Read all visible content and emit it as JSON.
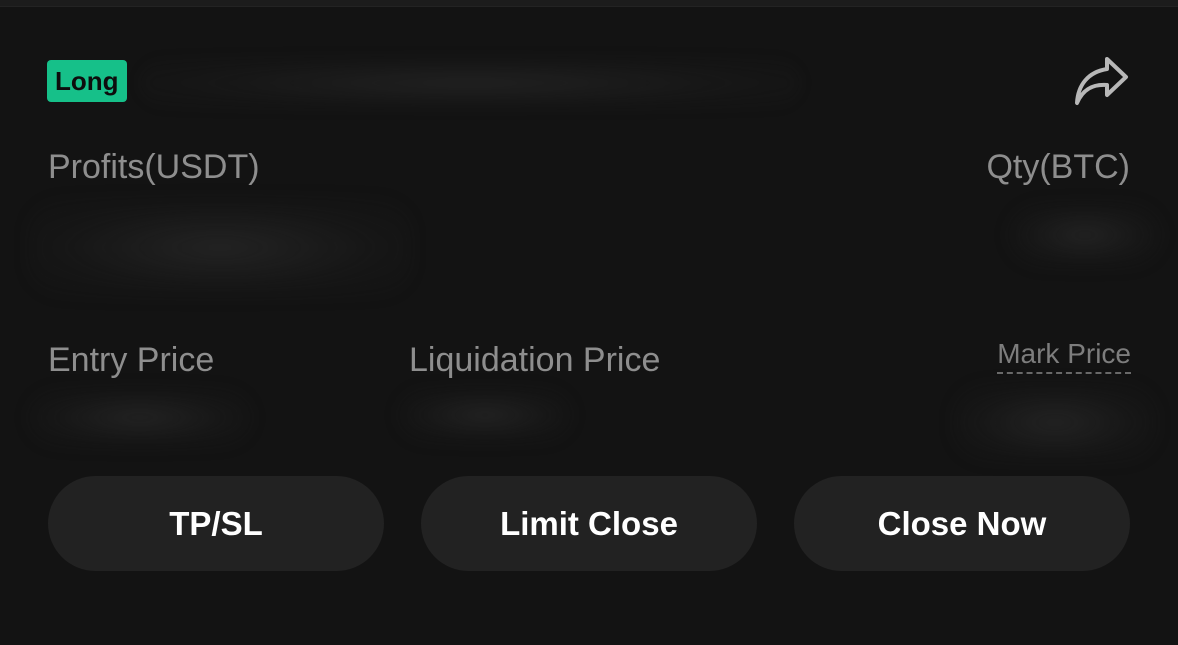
{
  "position": {
    "side_badge": "Long",
    "badge_color": "#16c089"
  },
  "header": {
    "share_icon": "share-icon"
  },
  "labels": {
    "profits": "Profits(USDT)",
    "qty": "Qty(BTC)",
    "entry_price": "Entry Price",
    "liquidation_price": "Liquidation Price",
    "mark_price": "Mark Price"
  },
  "actions": {
    "tpsl": "TP/SL",
    "limit_close": "Limit Close",
    "close_now": "Close Now"
  },
  "colors": {
    "background": "#131313",
    "button": "#222222",
    "label": "#8e8e8e"
  }
}
